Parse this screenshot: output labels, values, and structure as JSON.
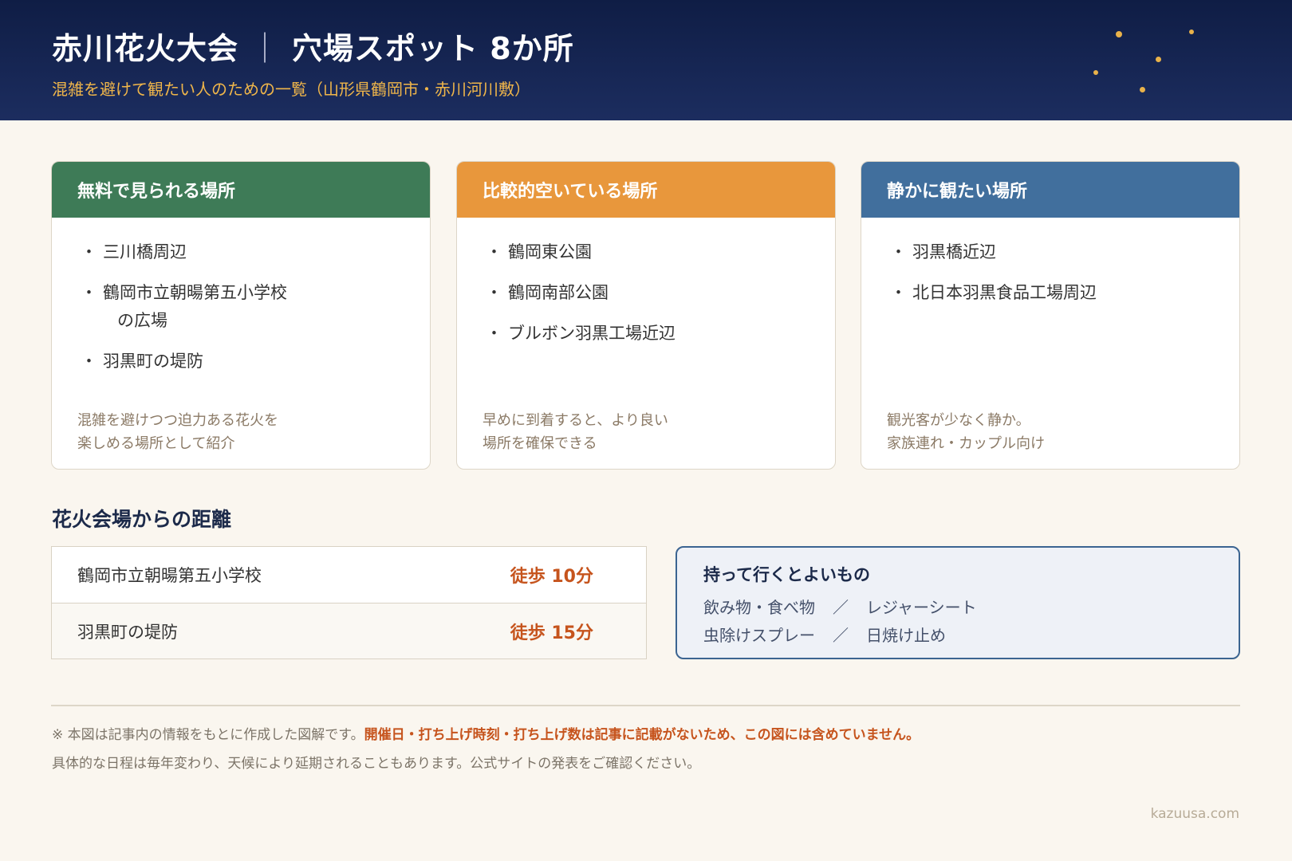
{
  "header": {
    "title_main": "赤川花火大会",
    "title_sep": "｜",
    "title_sub": "穴場スポット 8か所",
    "subtitle": "混雑を避けて観たい人のための一覧（山形県鶴岡市・赤川河川敷）",
    "accent_color": "#f0b64a"
  },
  "cards": [
    {
      "title": "無料で見られる場所",
      "color": "#3e7b57",
      "items": [
        "三川橋周辺",
        "鶴岡市立朝暘第五小学校",
        "の広場",
        "羽黒町の堤防"
      ],
      "note_lines": [
        "混雑を避けつつ迫力ある花火を",
        "楽しめる場所として紹介"
      ]
    },
    {
      "title": "比較的空いている場所",
      "color": "#e8973c",
      "items": [
        "鶴岡東公園",
        "鶴岡南部公園",
        "ブルボン羽黒工場近辺"
      ],
      "note_lines": [
        "早めに到着すると、より良い",
        "場所を確保できる"
      ]
    },
    {
      "title": "静かに観たい場所",
      "color": "#416f9d",
      "items": [
        "羽黒橋近辺",
        "北日本羽黒食品工場周辺"
      ],
      "note_lines": [
        "観光客が少なく静か。",
        "家族連れ・カップル向け"
      ]
    }
  ],
  "distance": {
    "heading": "花火会場からの距離",
    "rows": [
      {
        "place": "鶴岡市立朝暘第五小学校",
        "time": "徒歩 10分"
      },
      {
        "place": "羽黒町の堤防",
        "time": "徒歩 15分"
      }
    ]
  },
  "items_box": {
    "title": "持って行くとよいもの",
    "line1_a": "飲み物・食べ物",
    "line1_b": "レジャーシート",
    "line2_a": "虫除けスプレー",
    "line2_b": "日焼け止め",
    "slash": "／"
  },
  "footer": {
    "note1_plain": "※ 本図は記事内の情報をもとに作成した図解です。",
    "note1_highlight": "開催日・打ち上げ時刻・打ち上げ数は記事に記載がないため、この図には含めていません。",
    "note2": "具体的な日程は毎年変わり、天候により延期されることもあります。公式サイトの発表をご確認ください。",
    "credit": "kazuusa.com"
  }
}
